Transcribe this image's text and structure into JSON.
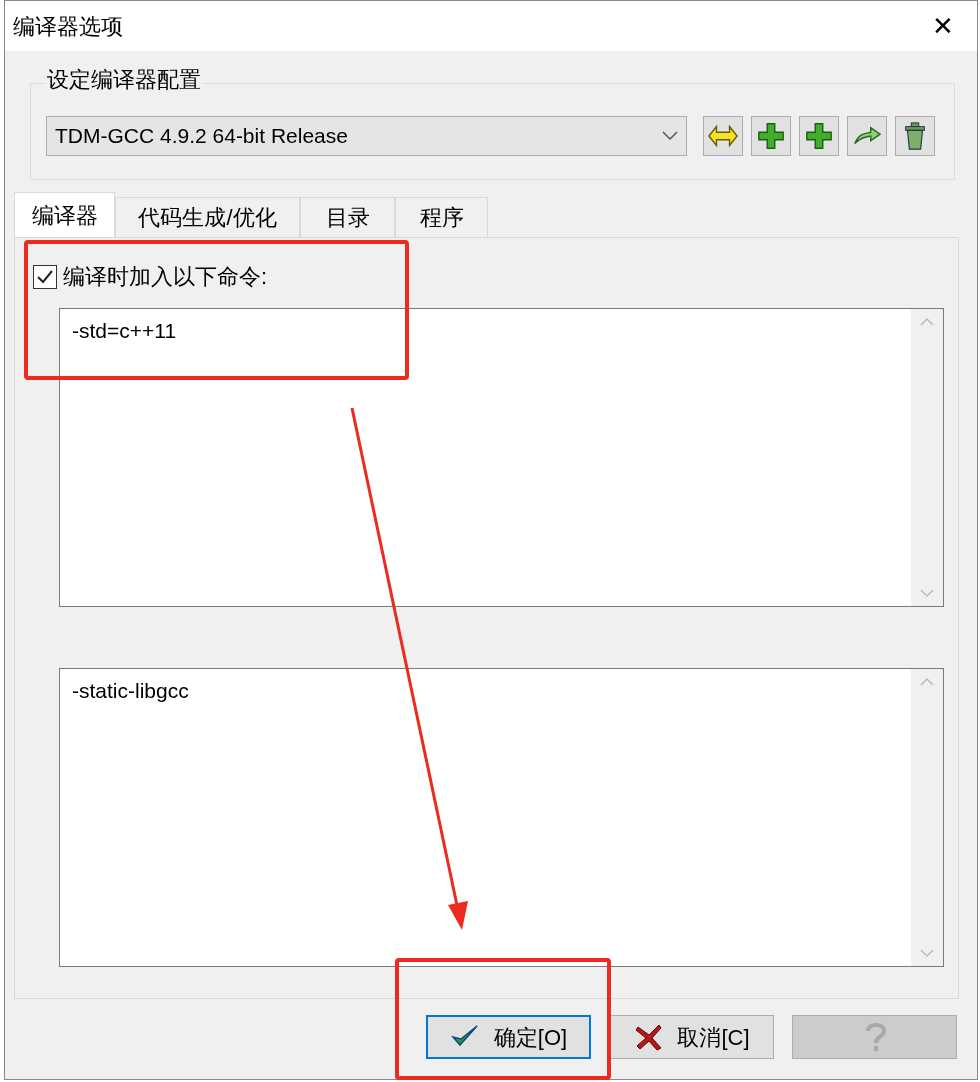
{
  "window": {
    "title": "编译器选项",
    "close": "✕"
  },
  "compiler_set": {
    "label": "设定编译器配置",
    "value": "TDM-GCC 4.9.2 64-bit Release",
    "tools": [
      {
        "kind": "rename"
      },
      {
        "kind": "add"
      },
      {
        "kind": "add"
      },
      {
        "kind": "export"
      },
      {
        "kind": "delete"
      }
    ]
  },
  "tabs": [
    {
      "label": "编译器",
      "selected": true
    },
    {
      "label": "代码生成/优化",
      "selected": false
    },
    {
      "label": "目录",
      "selected": false
    },
    {
      "label": "程序",
      "selected": false
    }
  ],
  "compile_commands": {
    "label": "编译时加入以下命令:",
    "checked": true,
    "value": "-std=c++11"
  },
  "linker_commands": {
    "value": "-static-libgcc"
  },
  "buttons": [
    {
      "kind": "ok",
      "label": "确定[O]",
      "default": true,
      "disabled": false
    },
    {
      "kind": "cancel",
      "label": "取消[C]",
      "default": false,
      "disabled": false
    },
    {
      "kind": "help",
      "default": false,
      "disabled": true
    }
  ],
  "annotations": [
    {
      "kind": "box"
    },
    {
      "kind": "box"
    },
    {
      "kind": "arrow"
    }
  ]
}
